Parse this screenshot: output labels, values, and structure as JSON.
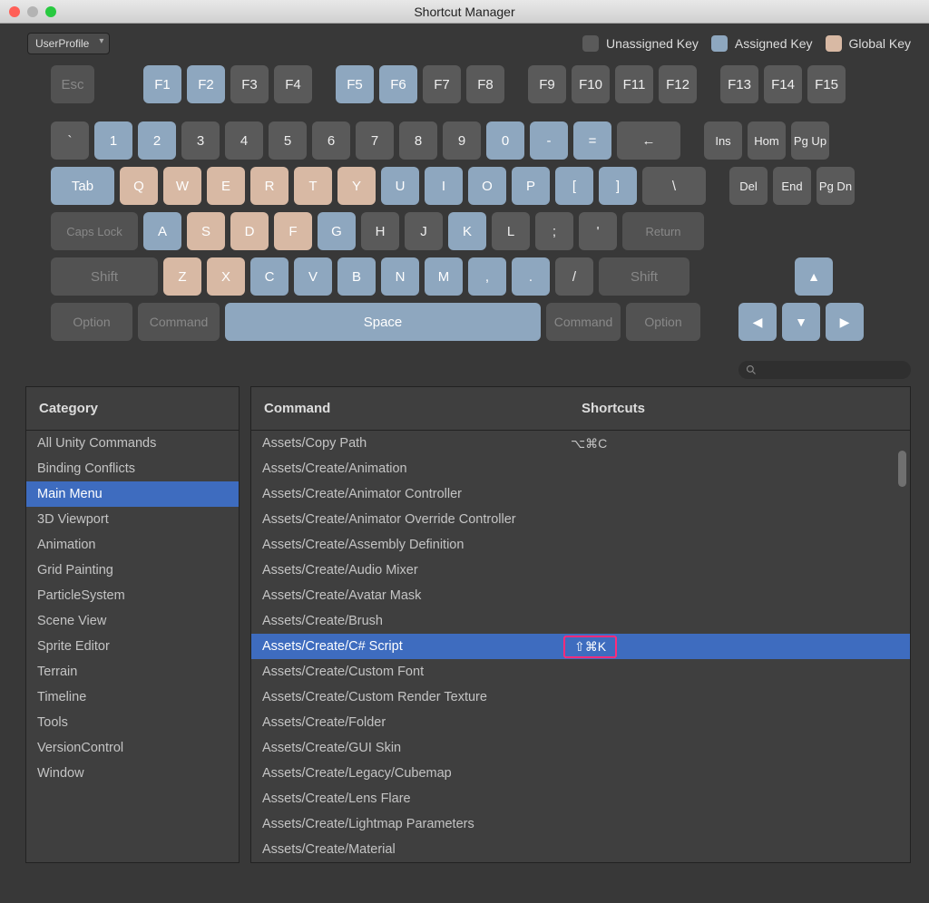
{
  "window": {
    "title": "Shortcut Manager"
  },
  "profile": {
    "selected": "UserProfile"
  },
  "legend": {
    "unassigned": "Unassigned Key",
    "assigned": "Assigned Key",
    "global": "Global Key"
  },
  "keyboard": {
    "row_fn": [
      {
        "label": "Esc",
        "w": "esc",
        "state": "dim"
      },
      {
        "gap": 42
      },
      {
        "label": "F1",
        "state": "assigned"
      },
      {
        "label": "F2",
        "state": "assigned"
      },
      {
        "label": "F3",
        "state": "dark"
      },
      {
        "label": "F4",
        "state": "dark"
      },
      {
        "gap": 14
      },
      {
        "label": "F5",
        "state": "assigned"
      },
      {
        "label": "F6",
        "state": "assigned"
      },
      {
        "label": "F7",
        "state": "dark"
      },
      {
        "label": "F8",
        "state": "dark"
      },
      {
        "gap": 14
      },
      {
        "label": "F9",
        "state": "dark"
      },
      {
        "label": "F10",
        "state": "dark"
      },
      {
        "label": "F11",
        "state": "dark"
      },
      {
        "label": "F12",
        "state": "dark"
      },
      {
        "gap": 14
      },
      {
        "label": "F13",
        "state": "dark"
      },
      {
        "label": "F14",
        "state": "dark"
      },
      {
        "label": "F15",
        "state": "dark"
      }
    ],
    "row_num": [
      {
        "label": "`",
        "state": "dark"
      },
      {
        "label": "1",
        "state": "assigned"
      },
      {
        "label": "2",
        "state": "assigned"
      },
      {
        "label": "3",
        "state": "dark"
      },
      {
        "label": "4",
        "state": "dark"
      },
      {
        "label": "5",
        "state": "dark"
      },
      {
        "label": "6",
        "state": "dark"
      },
      {
        "label": "7",
        "state": "dark"
      },
      {
        "label": "8",
        "state": "dark"
      },
      {
        "label": "9",
        "state": "dark"
      },
      {
        "label": "0",
        "state": "assigned"
      },
      {
        "label": "-",
        "state": "assigned"
      },
      {
        "label": "=",
        "state": "assigned"
      },
      {
        "label": "←",
        "w": "wide",
        "state": "dark"
      },
      {
        "gap": 14
      },
      {
        "label": "Ins",
        "state": "dark",
        "small": true
      },
      {
        "label": "Hom",
        "state": "dark",
        "small": true
      },
      {
        "label": "Pg Up",
        "state": "dark",
        "small": true
      }
    ],
    "row_q": [
      {
        "label": "Tab",
        "w": "tab",
        "state": "assigned"
      },
      {
        "label": "Q",
        "state": "global"
      },
      {
        "label": "W",
        "state": "global"
      },
      {
        "label": "E",
        "state": "global"
      },
      {
        "label": "R",
        "state": "global"
      },
      {
        "label": "T",
        "state": "global"
      },
      {
        "label": "Y",
        "state": "global"
      },
      {
        "label": "U",
        "state": "assigned"
      },
      {
        "label": "I",
        "state": "assigned"
      },
      {
        "label": "O",
        "state": "assigned"
      },
      {
        "label": "P",
        "state": "assigned"
      },
      {
        "label": "[",
        "state": "assigned"
      },
      {
        "label": "]",
        "state": "assigned"
      },
      {
        "label": "\\",
        "w": "wide",
        "state": "dark"
      },
      {
        "gap": 14
      },
      {
        "label": "Del",
        "state": "dark",
        "small": true
      },
      {
        "label": "End",
        "state": "dark",
        "small": true
      },
      {
        "label": "Pg Dn",
        "state": "dark",
        "small": true
      }
    ],
    "row_a": [
      {
        "label": "Caps Lock",
        "w": "caps",
        "state": "dim",
        "small": true
      },
      {
        "label": "A",
        "state": "assigned"
      },
      {
        "label": "S",
        "state": "global"
      },
      {
        "label": "D",
        "state": "global"
      },
      {
        "label": "F",
        "state": "global"
      },
      {
        "label": "G",
        "state": "assigned"
      },
      {
        "label": "H",
        "state": "dark"
      },
      {
        "label": "J",
        "state": "dark"
      },
      {
        "label": "K",
        "state": "assigned"
      },
      {
        "label": "L",
        "state": "dark"
      },
      {
        "label": ";",
        "state": "dark"
      },
      {
        "label": "'",
        "state": "dark"
      },
      {
        "label": "Return",
        "w": "ret",
        "state": "dim",
        "small": true
      }
    ],
    "row_z": [
      {
        "label": "Shift",
        "w": "shift",
        "state": "dim"
      },
      {
        "label": "Z",
        "state": "global"
      },
      {
        "label": "X",
        "state": "global"
      },
      {
        "label": "C",
        "state": "assigned"
      },
      {
        "label": "V",
        "state": "assigned"
      },
      {
        "label": "B",
        "state": "assigned"
      },
      {
        "label": "N",
        "state": "assigned"
      },
      {
        "label": "M",
        "state": "assigned"
      },
      {
        "label": ",",
        "state": "assigned"
      },
      {
        "label": ".",
        "state": "assigned"
      },
      {
        "label": "/",
        "state": "dark"
      },
      {
        "label": "Shift",
        "w": "rshift",
        "state": "dim"
      },
      {
        "gap": 104
      },
      {
        "label": "▲",
        "state": "assigned",
        "arrow": true
      }
    ],
    "row_mod": [
      {
        "label": "Option",
        "w": "mod",
        "state": "dim"
      },
      {
        "label": "Command",
        "w": "mod",
        "state": "dim"
      },
      {
        "label": "Space",
        "w": "space",
        "state": "assigned"
      },
      {
        "label": "Command",
        "w": "mod2",
        "state": "dim"
      },
      {
        "label": "Option",
        "w": "mod2",
        "state": "dim"
      },
      {
        "gap": 30
      },
      {
        "label": "◀",
        "state": "assigned",
        "arrow": true
      },
      {
        "label": "▼",
        "state": "assigned",
        "arrow": true
      },
      {
        "label": "▶",
        "state": "assigned",
        "arrow": true
      }
    ]
  },
  "headers": {
    "category": "Category",
    "command": "Command",
    "shortcuts": "Shortcuts"
  },
  "categories": [
    {
      "label": "All Unity Commands"
    },
    {
      "label": "Binding Conflicts"
    },
    {
      "label": "Main Menu",
      "selected": true
    },
    {
      "label": "3D Viewport"
    },
    {
      "label": "Animation"
    },
    {
      "label": "Grid Painting"
    },
    {
      "label": "ParticleSystem"
    },
    {
      "label": "Scene View"
    },
    {
      "label": "Sprite Editor"
    },
    {
      "label": "Terrain"
    },
    {
      "label": "Timeline"
    },
    {
      "label": "Tools"
    },
    {
      "label": "VersionControl"
    },
    {
      "label": "Window"
    }
  ],
  "commands": [
    {
      "name": "Assets/Copy Path",
      "shortcut": "⌥⌘C"
    },
    {
      "name": "Assets/Create/Animation"
    },
    {
      "name": "Assets/Create/Animator Controller"
    },
    {
      "name": "Assets/Create/Animator Override Controller"
    },
    {
      "name": "Assets/Create/Assembly Definition"
    },
    {
      "name": "Assets/Create/Audio Mixer"
    },
    {
      "name": "Assets/Create/Avatar Mask"
    },
    {
      "name": "Assets/Create/Brush"
    },
    {
      "name": "Assets/Create/C# Script",
      "shortcut": "⇧⌘K",
      "selected": true,
      "highlight": true
    },
    {
      "name": "Assets/Create/Custom Font"
    },
    {
      "name": "Assets/Create/Custom Render Texture"
    },
    {
      "name": "Assets/Create/Folder"
    },
    {
      "name": "Assets/Create/GUI Skin"
    },
    {
      "name": "Assets/Create/Legacy/Cubemap"
    },
    {
      "name": "Assets/Create/Lens Flare"
    },
    {
      "name": "Assets/Create/Lightmap Parameters"
    },
    {
      "name": "Assets/Create/Material"
    }
  ]
}
